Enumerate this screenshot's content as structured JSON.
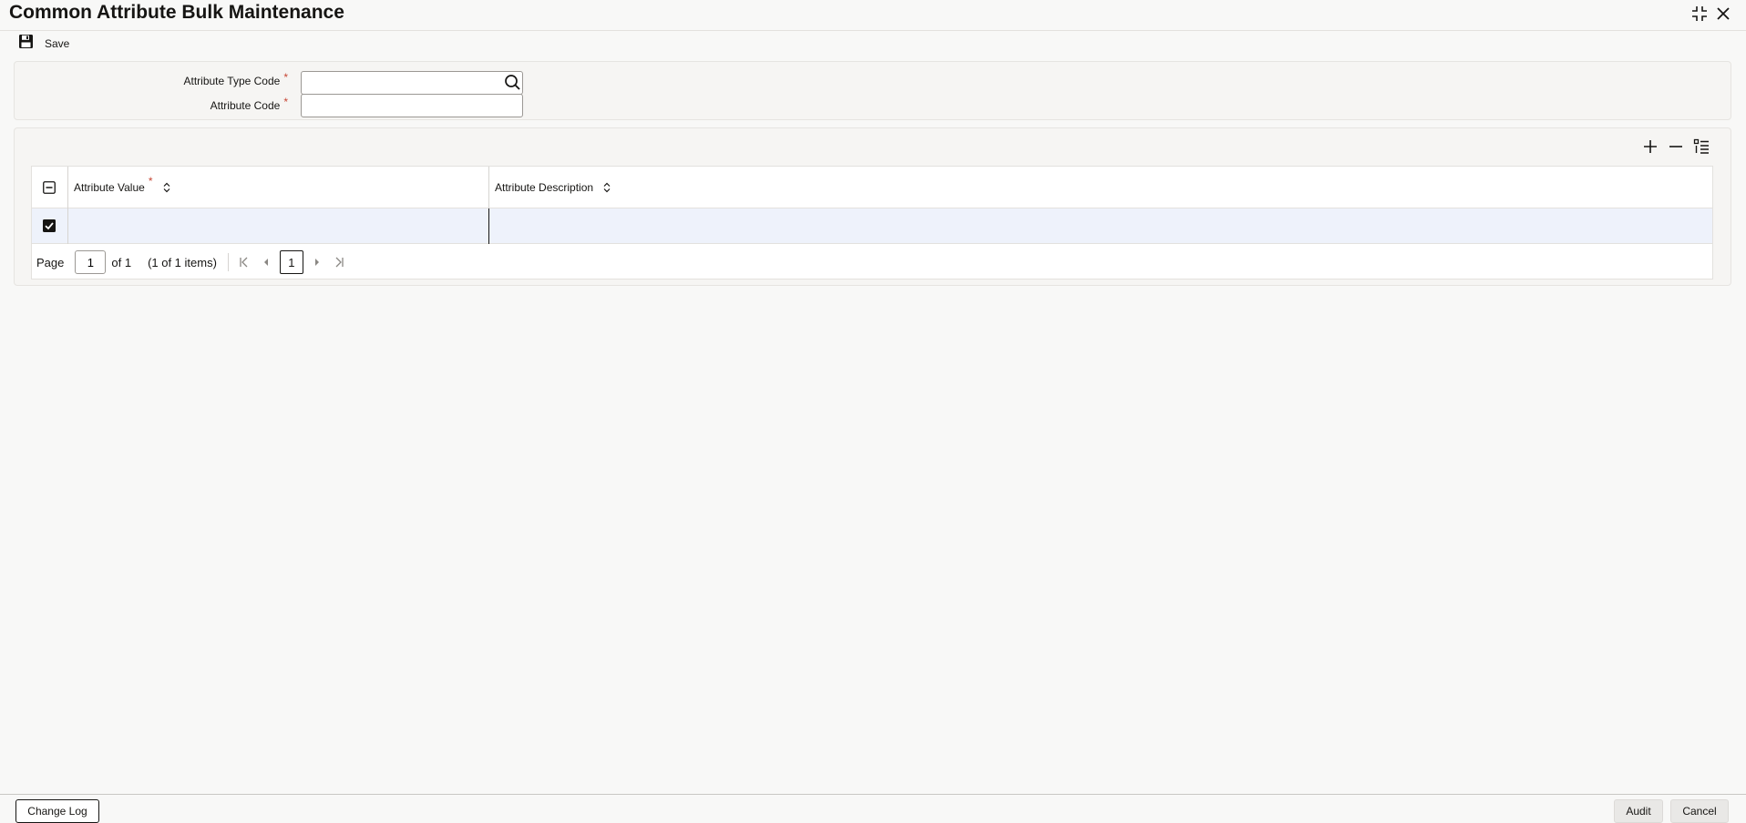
{
  "window": {
    "title": "Common Attribute Bulk Maintenance",
    "icons": {
      "minimize": "collapse-icon",
      "close": "close-icon"
    }
  },
  "toolbar": {
    "save_label": "Save",
    "save_icon": "floppy-disk-icon"
  },
  "form": {
    "attribute_type_code": {
      "label": "Attribute Type Code",
      "required_mark": "*",
      "value": "",
      "icon": "search-icon"
    },
    "attribute_code": {
      "label": "Attribute Code",
      "required_mark": "*",
      "value": ""
    }
  },
  "grid": {
    "tools": {
      "add": "plus-icon",
      "remove": "minus-icon",
      "view": "list-view-icon"
    },
    "columns": [
      {
        "label": "Attribute Value",
        "required_mark": "*",
        "sortable": true
      },
      {
        "label": "Attribute Description",
        "sortable": false
      }
    ],
    "rows": [
      {
        "checked": true,
        "attribute_value": "",
        "attribute_description": ""
      }
    ],
    "header_checkbox_state": "indeterminate",
    "pager": {
      "page_label": "Page",
      "page_value": "1",
      "of_text": "of 1",
      "items_text": "(1 of 1 items)",
      "current_page": "1"
    }
  },
  "footer": {
    "change_log_label": "Change Log",
    "audit_label": "Audit",
    "cancel_label": "Cancel"
  },
  "colors": {
    "accent_required": "#c74634",
    "selected_row": "#eef2fb",
    "panel_bg": "#f6f5f3",
    "text": "#161513"
  }
}
